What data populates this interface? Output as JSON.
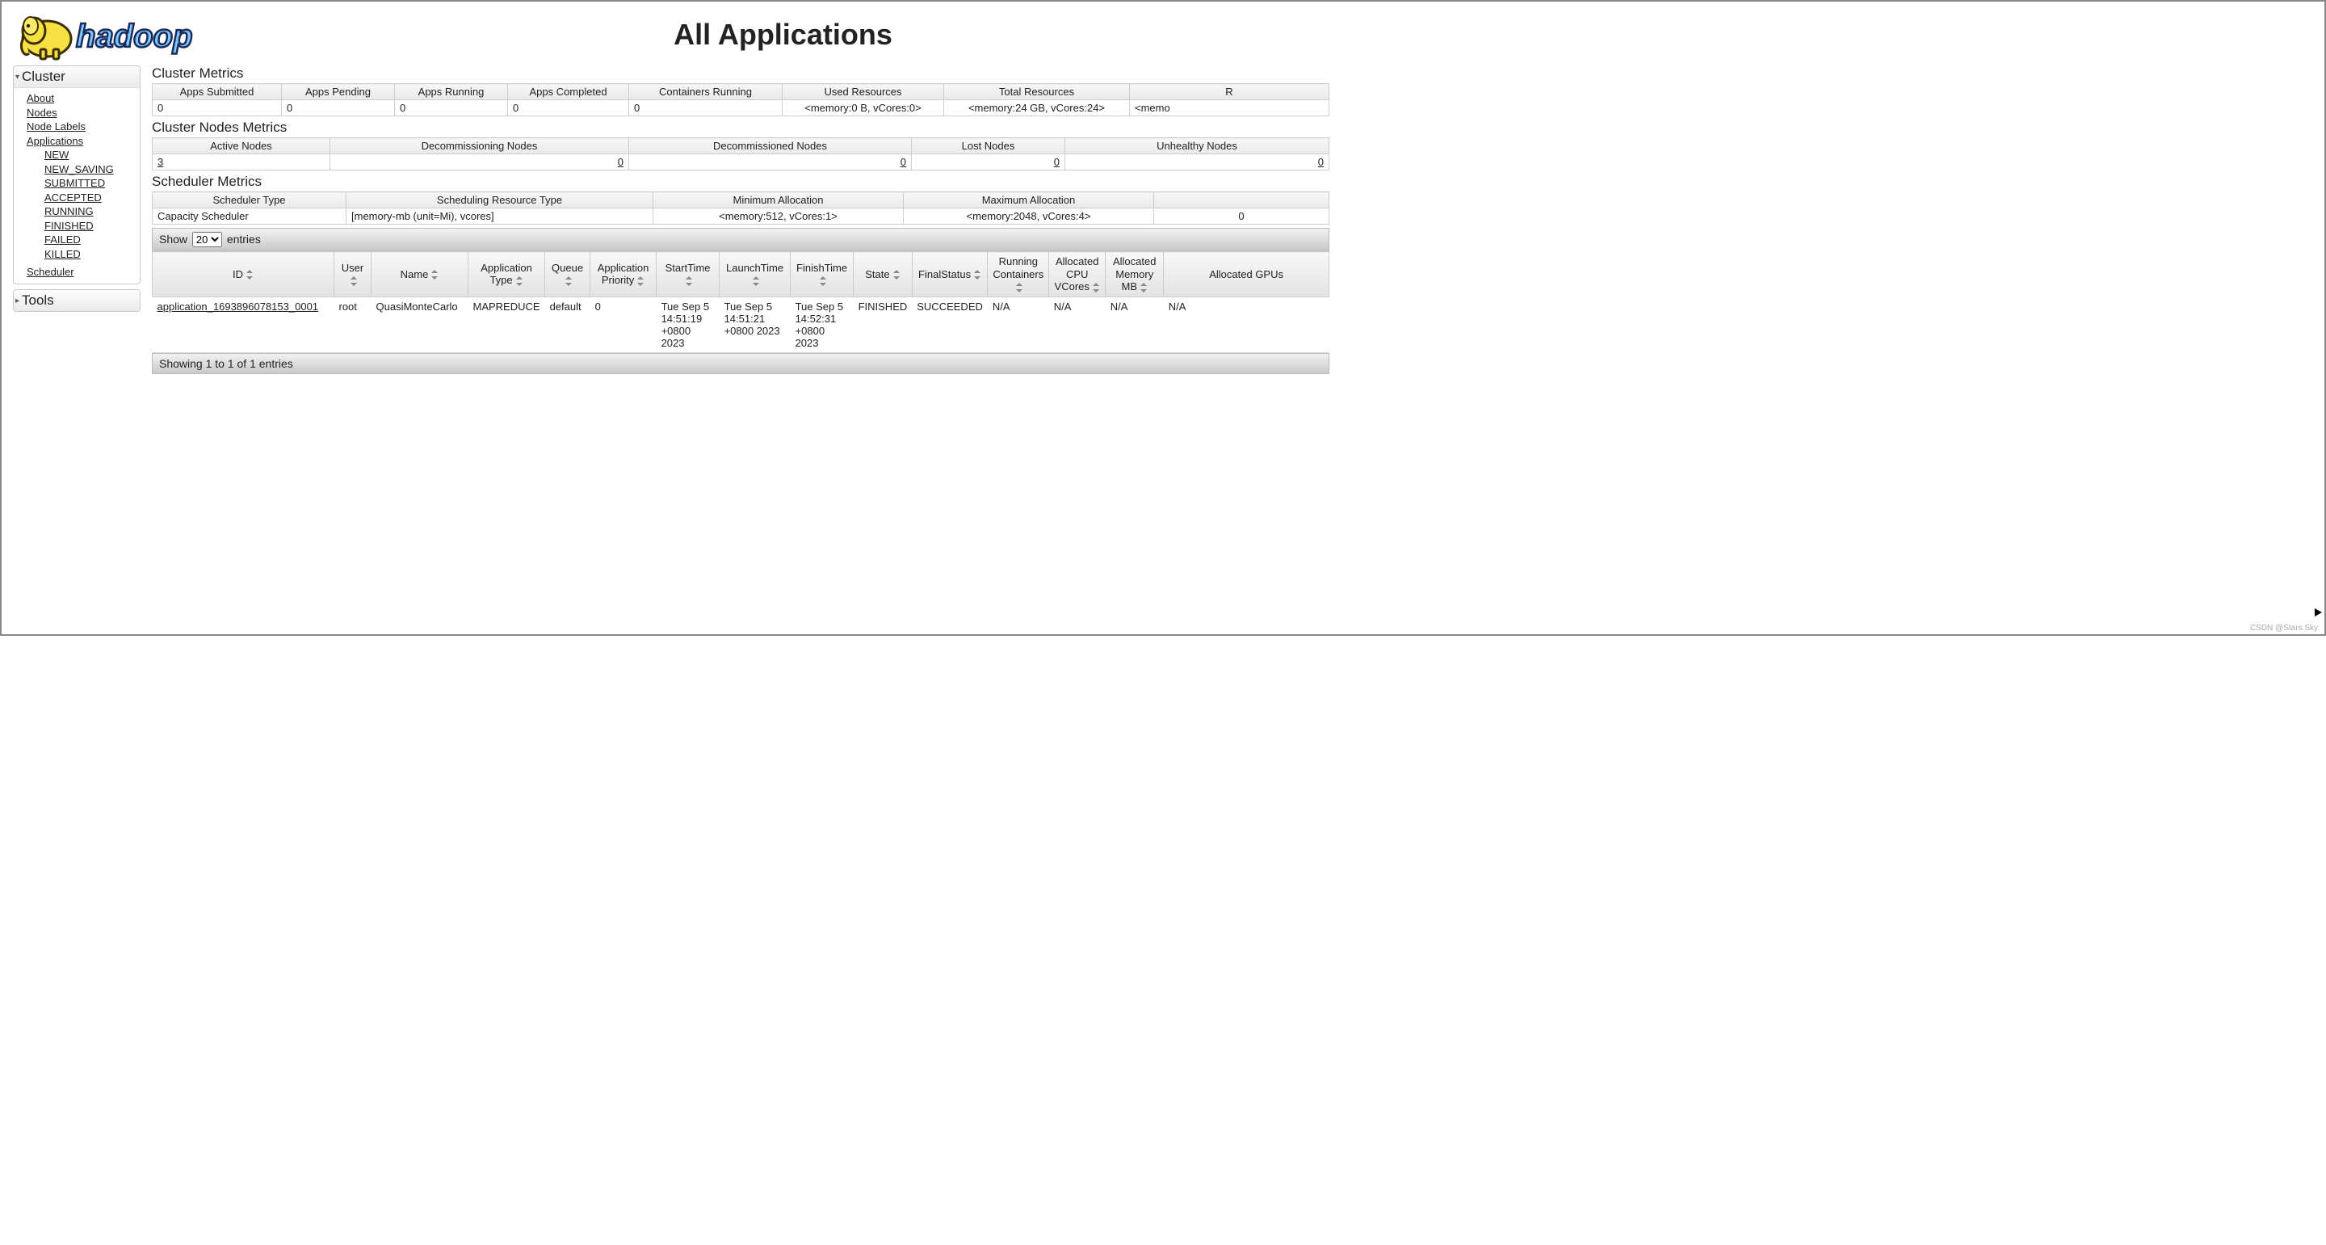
{
  "header": {
    "title": "All Applications",
    "logo_text": "hadoop"
  },
  "sidebar": {
    "cluster_label": "Cluster",
    "tools_label": "Tools",
    "items": [
      {
        "label": "About"
      },
      {
        "label": "Nodes"
      },
      {
        "label": "Node Labels"
      },
      {
        "label": "Applications"
      }
    ],
    "app_states": [
      {
        "label": "NEW"
      },
      {
        "label": "NEW_SAVING"
      },
      {
        "label": "SUBMITTED"
      },
      {
        "label": "ACCEPTED"
      },
      {
        "label": "RUNNING"
      },
      {
        "label": "FINISHED"
      },
      {
        "label": "FAILED"
      },
      {
        "label": "KILLED"
      }
    ],
    "scheduler_label": "Scheduler"
  },
  "cluster_metrics": {
    "title": "Cluster Metrics",
    "headers": [
      "Apps Submitted",
      "Apps Pending",
      "Apps Running",
      "Apps Completed",
      "Containers Running",
      "Used Resources",
      "Total Resources",
      "R"
    ],
    "row": [
      "0",
      "0",
      "0",
      "0",
      "0",
      "<memory:0 B, vCores:0>",
      "<memory:24 GB, vCores:24>",
      "<memo"
    ]
  },
  "nodes_metrics": {
    "title": "Cluster Nodes Metrics",
    "headers": [
      "Active Nodes",
      "Decommissioning Nodes",
      "Decommissioned Nodes",
      "Lost Nodes",
      "Unhealthy Nodes"
    ],
    "row": [
      "3",
      "0",
      "0",
      "0",
      "0"
    ]
  },
  "scheduler_metrics": {
    "title": "Scheduler Metrics",
    "headers": [
      "Scheduler Type",
      "Scheduling Resource Type",
      "Minimum Allocation",
      "Maximum Allocation",
      ""
    ],
    "row": [
      "Capacity Scheduler",
      "[memory-mb (unit=Mi), vcores]",
      "<memory:512, vCores:1>",
      "<memory:2048, vCores:4>",
      "0"
    ]
  },
  "datatable": {
    "show_prefix": "Show",
    "show_suffix": "entries",
    "page_size": "20",
    "columns": [
      "ID",
      "User",
      "Name",
      "Application Type",
      "Queue",
      "Application Priority",
      "StartTime",
      "LaunchTime",
      "FinishTime",
      "State",
      "FinalStatus",
      "Running Containers",
      "Allocated CPU VCores",
      "Allocated Memory MB",
      "Allocated GPUs"
    ],
    "rows": [
      {
        "id": "application_1693896078153_0001",
        "user": "root",
        "name": "QuasiMonteCarlo",
        "type": "MAPREDUCE",
        "queue": "default",
        "priority": "0",
        "start": "Tue Sep 5 14:51:19 +0800 2023",
        "launch": "Tue Sep 5 14:51:21 +0800 2023",
        "finish": "Tue Sep 5 14:52:31 +0800 2023",
        "state": "FINISHED",
        "final": "SUCCEEDED",
        "running_containers": "N/A",
        "alloc_vcores": "N/A",
        "alloc_mem": "N/A",
        "alloc_gpus": "N/A"
      }
    ],
    "footer": "Showing 1 to 1 of 1 entries"
  },
  "watermark": "CSDN @Stars.Sky"
}
